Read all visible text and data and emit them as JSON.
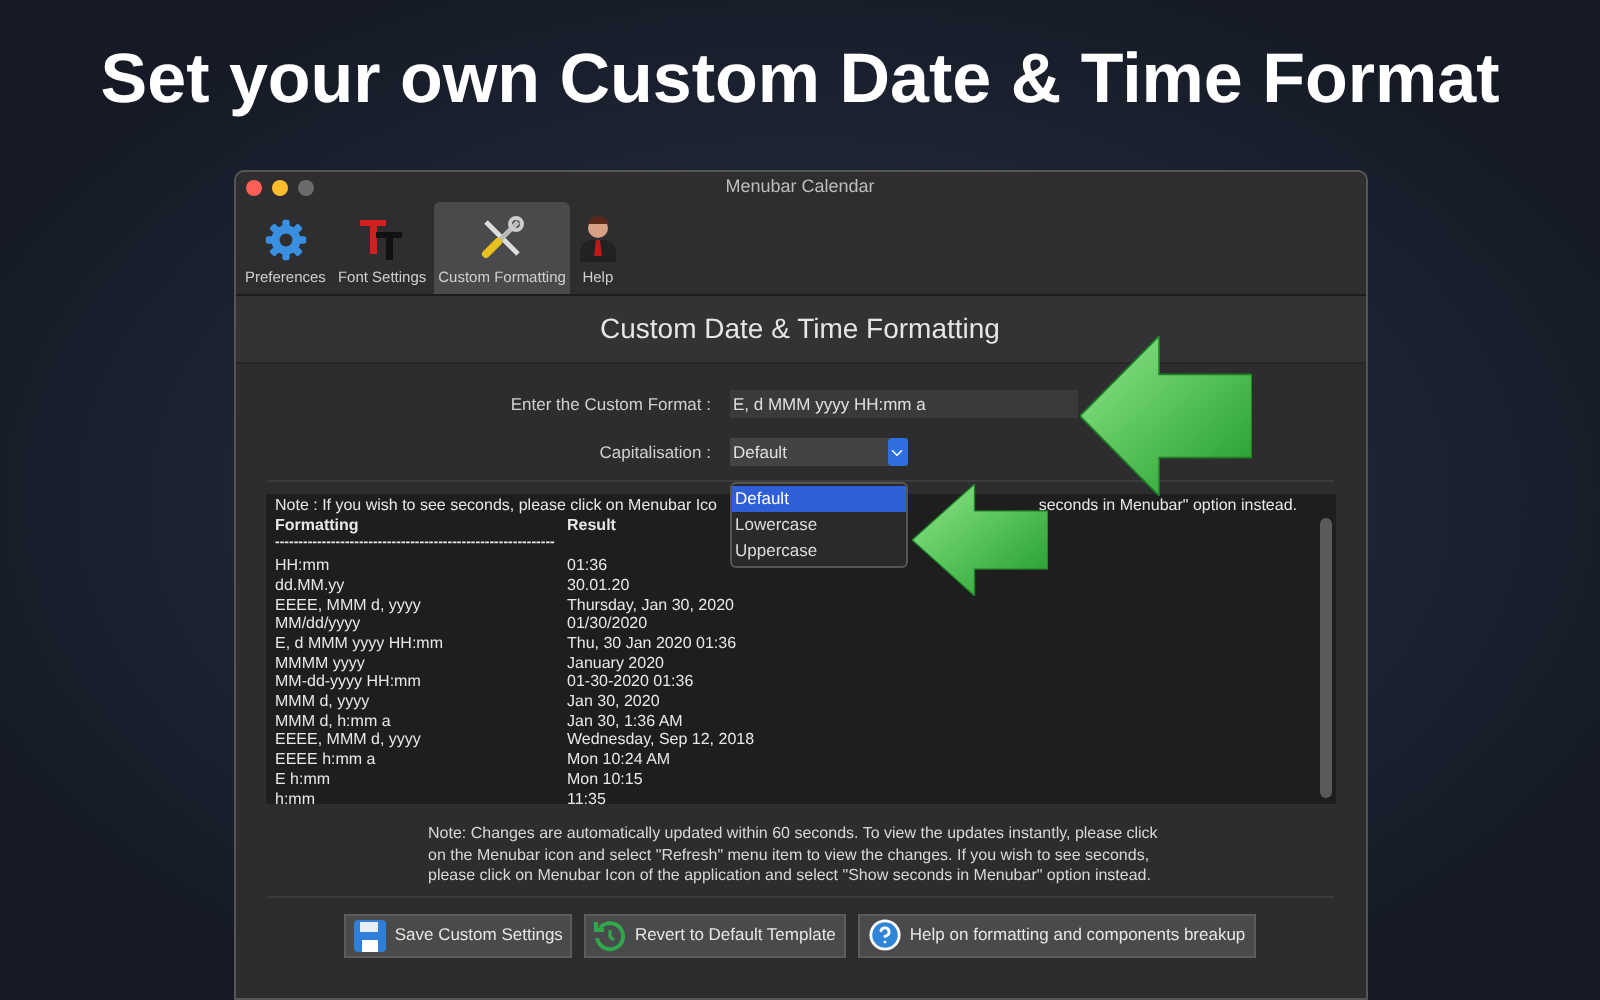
{
  "headline": "Set your own Custom Date & Time Format",
  "window": {
    "title": "Menubar Calendar"
  },
  "tabs": [
    {
      "label": "Preferences",
      "kind": "gear",
      "selected": false
    },
    {
      "label": "Font Settings",
      "kind": "font",
      "selected": false
    },
    {
      "label": "Custom Formatting",
      "kind": "tools",
      "selected": true
    },
    {
      "label": "Help",
      "kind": "person",
      "selected": false
    }
  ],
  "heading": "Custom Date & Time Formatting",
  "format_field": {
    "label": "Enter the Custom Format :",
    "value": "E, d MMM yyyy HH:mm a"
  },
  "capitalisation": {
    "label": "Capitalisation :",
    "value": "Default",
    "expanded": true,
    "options": [
      {
        "label": "Default",
        "selected": true
      },
      {
        "label": "Lowercase",
        "selected": false
      },
      {
        "label": "Uppercase",
        "selected": false
      }
    ]
  },
  "results": {
    "note_start": "Note : If you wish to see seconds, please click on Menubar Ico",
    "note_end": "seconds in Menubar\" option instead.",
    "columns": [
      "Formatting",
      "Result"
    ],
    "separator": "------------------------------------------------------------",
    "rows": [
      [
        "HH:mm",
        "01:36"
      ],
      [
        "dd.MM.yy",
        "30.01.20"
      ],
      [
        "EEEE, MMM d, yyyy",
        "Thursday, Jan 30, 2020"
      ],
      [
        "MM/dd/yyyy",
        "01/30/2020"
      ],
      [
        "E, d MMM yyyy HH:mm",
        "Thu, 30 Jan 2020 01:36"
      ],
      [
        "MMMM yyyy",
        "January 2020"
      ],
      [
        "MM-dd-yyyy HH:mm",
        "01-30-2020 01:36"
      ],
      [
        "MMM d, yyyy",
        "Jan 30, 2020"
      ],
      [
        "MMM d, h:mm a",
        "Jan 30, 1:36 AM"
      ],
      [
        "EEEE, MMM d, yyyy",
        "Wednesday, Sep 12, 2018"
      ],
      [
        "EEEE h:mm a",
        "Mon 10:24 AM"
      ],
      [
        "E h:mm",
        "Mon 10:15"
      ],
      [
        "h:mm",
        "11:35"
      ]
    ]
  },
  "note": "Note: Changes are automatically updated within 60 seconds. To view the updates instantly, please click on the Menubar icon and select \"Refresh\" menu item to view the changes. If you wish to see seconds, please click on Menubar Icon of the application and select \"Show seconds in Menubar\" option instead.",
  "buttons": [
    {
      "label": "Save Custom Settings",
      "kind": "save"
    },
    {
      "label": "Revert to Default Template",
      "kind": "revert"
    },
    {
      "label": "Help on formatting and components breakup",
      "kind": "help"
    }
  ]
}
